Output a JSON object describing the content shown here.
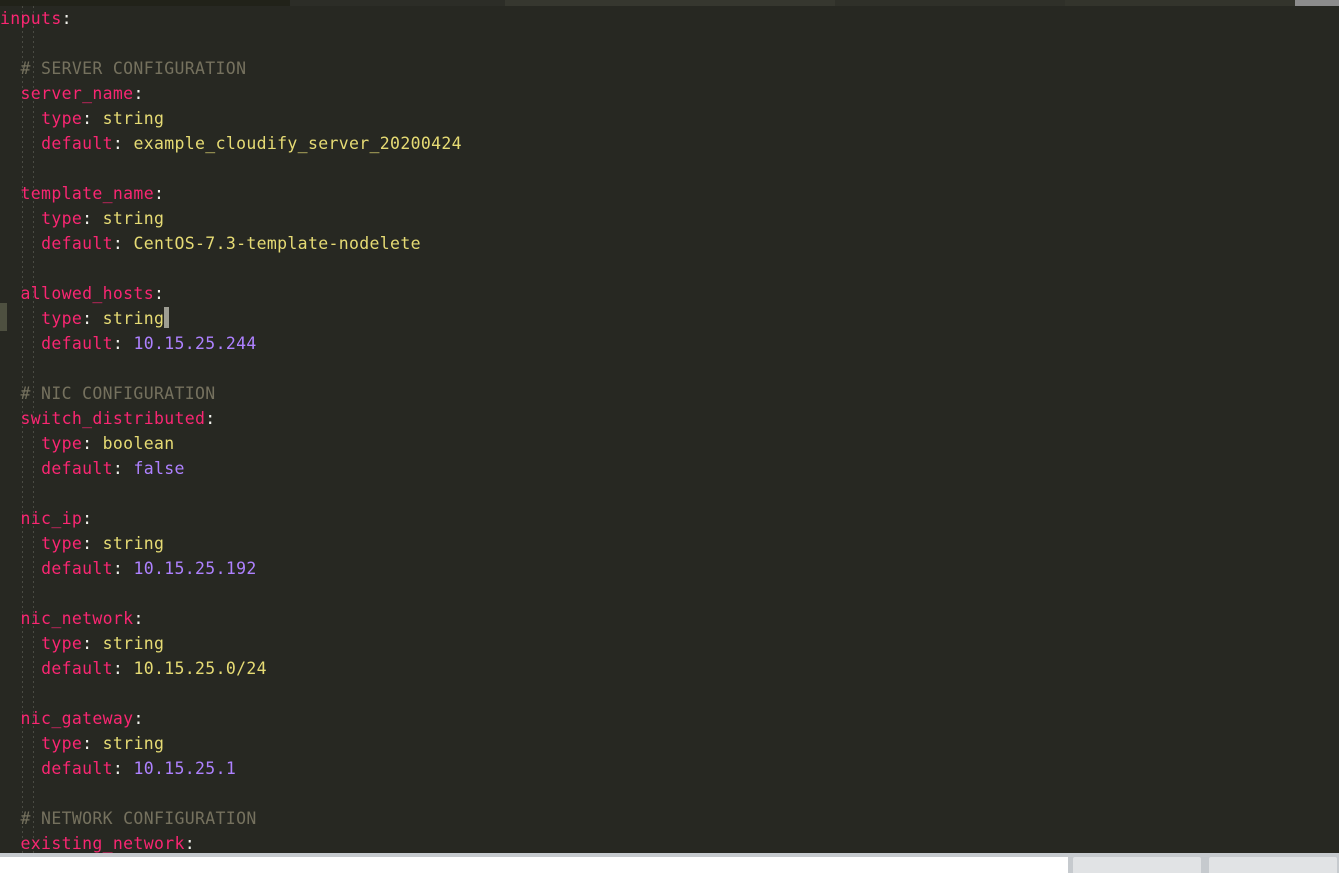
{
  "window": {
    "tab_strip_segments": [
      "seg-a",
      "seg-b",
      "seg-c",
      "seg-d",
      "seg-e",
      "seg-f"
    ]
  },
  "theme": {
    "background": "#272822",
    "key_color": "#f92672",
    "string_color": "#e6db74",
    "number_color": "#ae81ff",
    "comment_color": "#75715e",
    "punctuation_color": "#f3f3ee",
    "caret_color": "#9e9e93",
    "change_marker_color": "#4e5040"
  },
  "document": {
    "root_key": "inputs",
    "root_colon": ":",
    "lines": [
      {
        "id": "l1",
        "indent": 0,
        "type": "key",
        "text": "inputs",
        "punc": ":"
      },
      {
        "id": "l2",
        "indent": 0,
        "type": "blank",
        "text": ""
      },
      {
        "id": "l3",
        "indent": 1,
        "type": "comment",
        "text": "# SERVER CONFIGURATION"
      },
      {
        "id": "l4",
        "indent": 1,
        "type": "key",
        "text": "server_name",
        "punc": ":"
      },
      {
        "id": "l5",
        "indent": 2,
        "type": "pair",
        "key": "type",
        "punc": ":",
        "value": "string",
        "value_kind": "string"
      },
      {
        "id": "l6",
        "indent": 2,
        "type": "pair",
        "key": "default",
        "punc": ":",
        "value": "example_cloudify_server_20200424",
        "value_kind": "string"
      },
      {
        "id": "l7",
        "indent": 0,
        "type": "blank",
        "text": ""
      },
      {
        "id": "l8",
        "indent": 1,
        "type": "key",
        "text": "template_name",
        "punc": ":"
      },
      {
        "id": "l9",
        "indent": 2,
        "type": "pair",
        "key": "type",
        "punc": ":",
        "value": "string",
        "value_kind": "string"
      },
      {
        "id": "l10",
        "indent": 2,
        "type": "pair",
        "key": "default",
        "punc": ":",
        "value": "CentOS-7.3-template-nodelete",
        "value_kind": "string"
      },
      {
        "id": "l11",
        "indent": 0,
        "type": "blank",
        "text": ""
      },
      {
        "id": "l12",
        "indent": 1,
        "type": "key",
        "text": "allowed_hosts",
        "punc": ":"
      },
      {
        "id": "l13",
        "indent": 2,
        "type": "pair",
        "key": "type",
        "punc": ":",
        "value": "string",
        "value_kind": "string",
        "caret_after": true
      },
      {
        "id": "l14",
        "indent": 2,
        "type": "pair",
        "key": "default",
        "punc": ":",
        "value": "10.15.25.244",
        "value_kind": "number"
      },
      {
        "id": "l15",
        "indent": 0,
        "type": "blank",
        "text": ""
      },
      {
        "id": "l16",
        "indent": 1,
        "type": "comment",
        "text": "# NIC CONFIGURATION"
      },
      {
        "id": "l17",
        "indent": 1,
        "type": "key",
        "text": "switch_distributed",
        "punc": ":"
      },
      {
        "id": "l18",
        "indent": 2,
        "type": "pair",
        "key": "type",
        "punc": ":",
        "value": "boolean",
        "value_kind": "string"
      },
      {
        "id": "l19",
        "indent": 2,
        "type": "pair",
        "key": "default",
        "punc": ":",
        "value": "false",
        "value_kind": "number"
      },
      {
        "id": "l20",
        "indent": 0,
        "type": "blank",
        "text": ""
      },
      {
        "id": "l21",
        "indent": 1,
        "type": "key",
        "text": "nic_ip",
        "punc": ":"
      },
      {
        "id": "l22",
        "indent": 2,
        "type": "pair",
        "key": "type",
        "punc": ":",
        "value": "string",
        "value_kind": "string"
      },
      {
        "id": "l23",
        "indent": 2,
        "type": "pair",
        "key": "default",
        "punc": ":",
        "value": "10.15.25.192",
        "value_kind": "number"
      },
      {
        "id": "l24",
        "indent": 0,
        "type": "blank",
        "text": ""
      },
      {
        "id": "l25",
        "indent": 1,
        "type": "key",
        "text": "nic_network",
        "punc": ":"
      },
      {
        "id": "l26",
        "indent": 2,
        "type": "pair",
        "key": "type",
        "punc": ":",
        "value": "string",
        "value_kind": "string"
      },
      {
        "id": "l27",
        "indent": 2,
        "type": "pair",
        "key": "default",
        "punc": ":",
        "value": "10.15.25.0/24",
        "value_kind": "string"
      },
      {
        "id": "l28",
        "indent": 0,
        "type": "blank",
        "text": ""
      },
      {
        "id": "l29",
        "indent": 1,
        "type": "key",
        "text": "nic_gateway",
        "punc": ":"
      },
      {
        "id": "l30",
        "indent": 2,
        "type": "pair",
        "key": "type",
        "punc": ":",
        "value": "string",
        "value_kind": "string"
      },
      {
        "id": "l31",
        "indent": 2,
        "type": "pair",
        "key": "default",
        "punc": ":",
        "value": "10.15.25.1",
        "value_kind": "number"
      },
      {
        "id": "l32",
        "indent": 0,
        "type": "blank",
        "text": ""
      },
      {
        "id": "l33",
        "indent": 1,
        "type": "comment",
        "text": "# NETWORK CONFIGURATION"
      },
      {
        "id": "l34",
        "indent": 1,
        "type": "key",
        "text": "existing_network",
        "punc": ":"
      }
    ]
  }
}
